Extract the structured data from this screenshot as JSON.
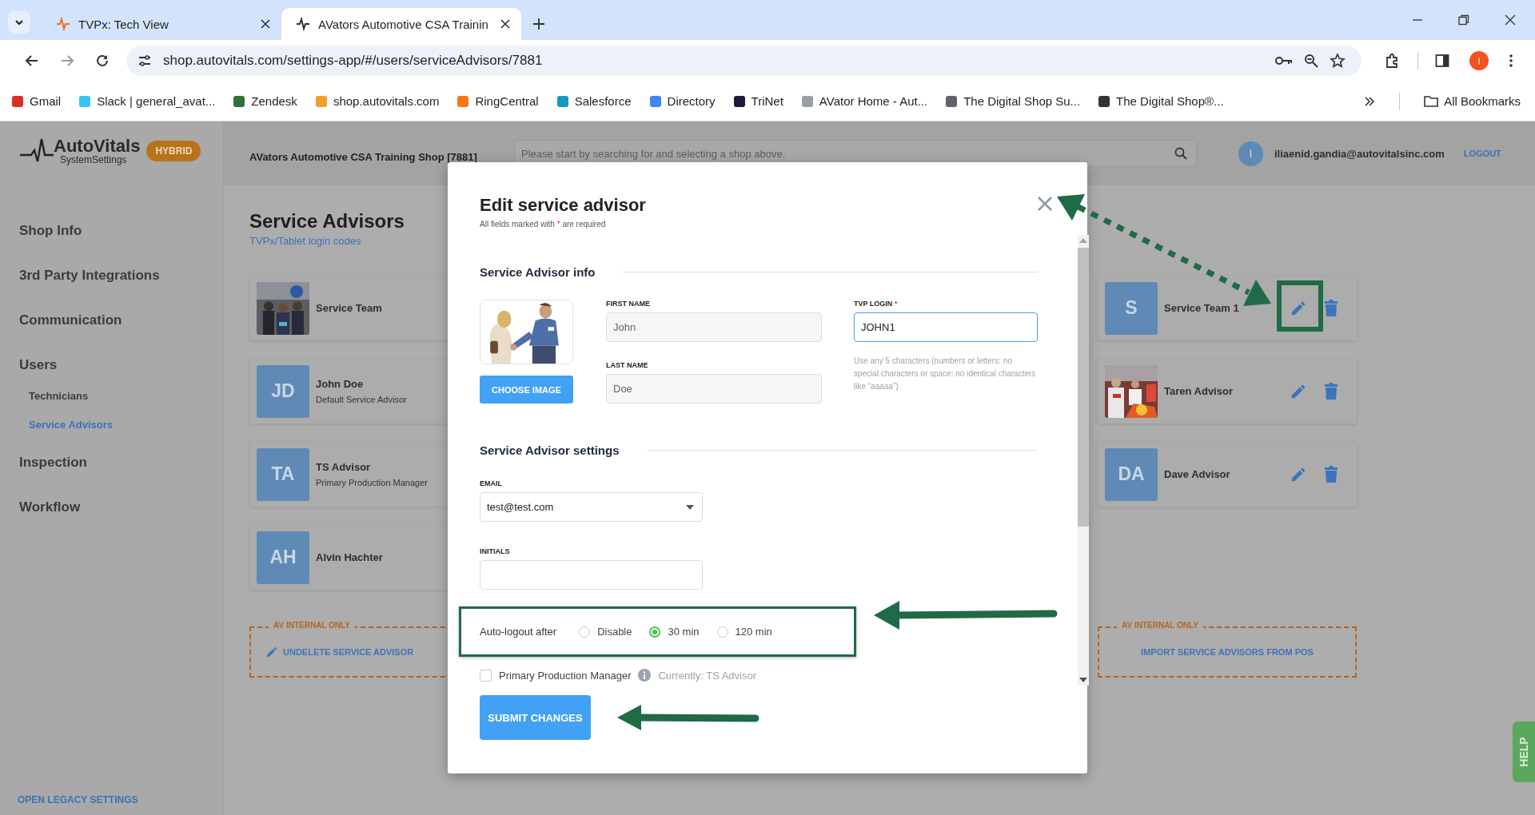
{
  "browser": {
    "tabs": [
      {
        "title": "TVPx: Tech View",
        "color": "#e8711a",
        "selected": false
      },
      {
        "title": "AVators Automotive CSA Trainin",
        "color": "#333333",
        "selected": true
      }
    ],
    "url": "shop.autovitals.com/settings-app/#/users/serviceAdvisors/7881",
    "profile_initial": "I",
    "bookmarks": [
      {
        "title": "Gmail",
        "color": "#d93025"
      },
      {
        "title": "Slack | general_avat...",
        "color": "#36c5f0"
      },
      {
        "title": "Zendesk",
        "color": "#2f6f3e"
      },
      {
        "title": "shop.autovitals.com",
        "color": "#f0a030"
      },
      {
        "title": "RingCentral",
        "color": "#f07a1a"
      },
      {
        "title": "Salesforce",
        "color": "#1798c1"
      },
      {
        "title": "Directory",
        "color": "#4285f4"
      },
      {
        "title": "TriNet",
        "color": "#1c1c3a"
      },
      {
        "title": "AVator Home - Aut...",
        "color": "#9aa0a6"
      },
      {
        "title": "The Digital Shop Su...",
        "color": "#5f6368"
      },
      {
        "title": "The Digital Shop®...",
        "color": "#333333"
      }
    ],
    "all_bookmarks": "All Bookmarks"
  },
  "app": {
    "logo": {
      "name": "AutoVitals",
      "subtitle": "SystemSettings",
      "badge": "HYBRID"
    },
    "shop_name": "AVators Automotive CSA Training Shop [7881]",
    "search": {
      "placeholder": "Please start by searching for and selecting a shop above."
    },
    "user": {
      "initial": "I",
      "email": "iliaenid.gandia@autovitalsinc.com",
      "logout": "LOGOUT"
    },
    "sidebar": {
      "items": [
        {
          "label": "Shop Info",
          "selected": false
        },
        {
          "label": "3rd Party Integrations",
          "selected": false
        },
        {
          "label": "Communication",
          "selected": false
        },
        {
          "label": "Users",
          "selected": false,
          "children": [
            {
              "label": "Technicians",
              "selected": false
            },
            {
              "label": "Service Advisors",
              "selected": true
            }
          ]
        },
        {
          "label": "Inspection",
          "selected": false
        },
        {
          "label": "Workflow",
          "selected": false
        }
      ],
      "footer_link": "OPEN LEGACY SETTINGS"
    },
    "page": {
      "title": "Service Advisors",
      "link": "TVPx/Tablet login codes",
      "left_cards": [
        {
          "name": "Service Team"
        },
        {
          "name": "John Doe",
          "subtitle": "Default Service Advisor",
          "avatar": {
            "kind": "initials",
            "text": "JD"
          }
        },
        {
          "name": "TS Advisor",
          "subtitle": "Primary Production Manager",
          "avatar": {
            "kind": "initials",
            "text": "TA"
          }
        },
        {
          "name": "Alvin Hachter",
          "avatar": {
            "kind": "initials",
            "text": "AH"
          }
        }
      ],
      "right_cards": [
        {
          "name": "Service Team 1",
          "avatar": {
            "kind": "initials",
            "text": "S"
          }
        },
        {
          "name": "Taren Advisor"
        },
        {
          "name": "Dave Advisor",
          "avatar": {
            "kind": "initials",
            "text": "DA"
          }
        }
      ],
      "internal_boxes": [
        {
          "legend": "AV INTERNAL ONLY",
          "action": "UNDELETE SERVICE ADVISOR",
          "kind": "edit"
        },
        {
          "legend": "AV INTERNAL ONLY",
          "action": "IMPORT SERVICE ADVISORS FROM POS",
          "kind": "plain"
        }
      ]
    },
    "help": "HELP"
  },
  "modal": {
    "title": "Edit service advisor",
    "note_before": "All fields marked with",
    "required_mark": "*",
    "note_after": "are required",
    "info_section": "Service Advisor info",
    "choose_image": "CHOOSE IMAGE",
    "first_name": {
      "label": "FIRST NAME",
      "value": "John",
      "disabled": true
    },
    "last_name": {
      "label": "LAST NAME",
      "value": "Doe",
      "disabled": true
    },
    "tvp_login": {
      "label": "TVP LOGIN",
      "required_mark": "*",
      "value": "JOHN1",
      "focused": true
    },
    "tvp_hint": "Use any 5 characters (numbers or letters: no special characters or space: no identical characters like “aaaaa”)",
    "settings_section": "Service Advisor settings",
    "email": {
      "label": "EMAIL",
      "value": "test@test.com"
    },
    "initials": {
      "label": "INITIALS"
    },
    "auto_logout": {
      "label": "Auto-logout after",
      "options": [
        {
          "label": "Disable",
          "selected": false
        },
        {
          "label": "30 min",
          "selected": true
        },
        {
          "label": "120 min",
          "selected": false
        }
      ]
    },
    "primary_manager": {
      "label": "Primary Production Manager",
      "checked": false,
      "current": "Currently: TS Advisor"
    },
    "submit": "SUBMIT CHANGES"
  }
}
